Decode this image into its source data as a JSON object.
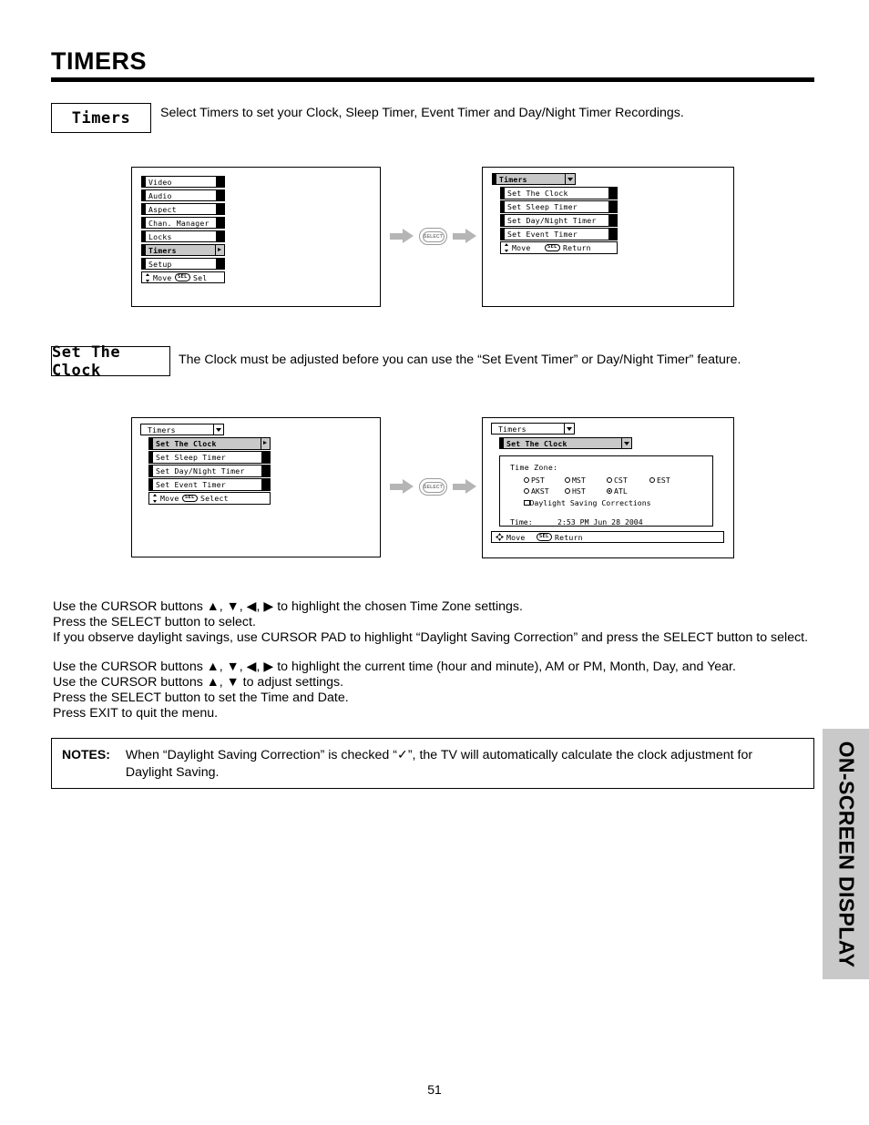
{
  "page": {
    "title": "TIMERS",
    "number": "51",
    "side_tab": "ON-SCREEN DISPLAY"
  },
  "sections": [
    {
      "label": "Timers",
      "description": "Select Timers to set your Clock, Sleep Timer, Event Timer and Day/Night Timer Recordings."
    },
    {
      "label": "Set The Clock",
      "description": "The Clock must be adjusted before you can use the “Set Event Timer” or Day/Night Timer” feature."
    }
  ],
  "flow": {
    "select_button_label": "SELECT",
    "arrow_color": "#b5b5b5"
  },
  "osd": {
    "sel_badge": "SEL",
    "panel1": {
      "items": [
        {
          "label": "Video",
          "selected": false
        },
        {
          "label": "Audio",
          "selected": false
        },
        {
          "label": "Aspect",
          "selected": false
        },
        {
          "label": "Chan. Manager",
          "selected": false
        },
        {
          "label": "Locks",
          "selected": false
        },
        {
          "label": "Timers",
          "selected": true
        },
        {
          "label": "Setup",
          "selected": false
        }
      ],
      "footer": {
        "move": "Move",
        "action": "Sel"
      }
    },
    "panel2": {
      "header": "Timers",
      "items": [
        {
          "label": "Set The Clock",
          "selected": false
        },
        {
          "label": "Set Sleep Timer",
          "selected": false
        },
        {
          "label": "Set Day/Night Timer",
          "selected": false
        },
        {
          "label": "Set Event Timer",
          "selected": false
        }
      ],
      "footer": {
        "move": "Move",
        "action": "Return"
      }
    },
    "panel3": {
      "header": "Timers",
      "items": [
        {
          "label": "Set The Clock",
          "selected": true
        },
        {
          "label": "Set Sleep Timer",
          "selected": false
        },
        {
          "label": "Set Day/Night Timer",
          "selected": false
        },
        {
          "label": "Set Event Timer",
          "selected": false
        }
      ],
      "footer": {
        "move": "Move",
        "action": "Select"
      }
    },
    "panel4": {
      "header": "Timers",
      "subheader": "Set The Clock",
      "time_zone_title": "Time Zone:",
      "zones_row1": [
        {
          "label": "PST",
          "selected": false
        },
        {
          "label": "MST",
          "selected": false
        },
        {
          "label": "CST",
          "selected": false
        },
        {
          "label": "EST",
          "selected": false
        }
      ],
      "zones_row2": [
        {
          "label": "AKST",
          "selected": false
        },
        {
          "label": "HST",
          "selected": false
        },
        {
          "label": "ATL",
          "selected": true
        }
      ],
      "daylight": {
        "label": "Daylight Saving Corrections",
        "checked": false
      },
      "time_label": "Time:",
      "time_value": "2:53 PM Jun 28 2004",
      "footer": {
        "move": "Move",
        "action": "Return"
      }
    }
  },
  "instructions": {
    "group1": [
      "Use the CURSOR buttons ▲, ▼, ◀, ▶ to highlight the chosen Time Zone settings.",
      "Press the SELECT button to select.",
      "If you observe daylight savings, use CURSOR PAD to highlight “Daylight Saving Correction” and press the SELECT button to select."
    ],
    "group2": [
      "Use the CURSOR buttons ▲, ▼, ◀, ▶ to highlight the current time (hour and minute), AM or PM, Month, Day, and Year.",
      "Use the CURSOR buttons ▲, ▼ to adjust settings.",
      "Press the SELECT button to set the Time and Date.",
      "Press EXIT to quit the menu."
    ]
  },
  "notes": {
    "label": "NOTES:",
    "line1": "When “Daylight Saving Correction” is checked “✓”, the TV will automatically calculate the clock adjustment for",
    "line2": "Daylight Saving."
  }
}
